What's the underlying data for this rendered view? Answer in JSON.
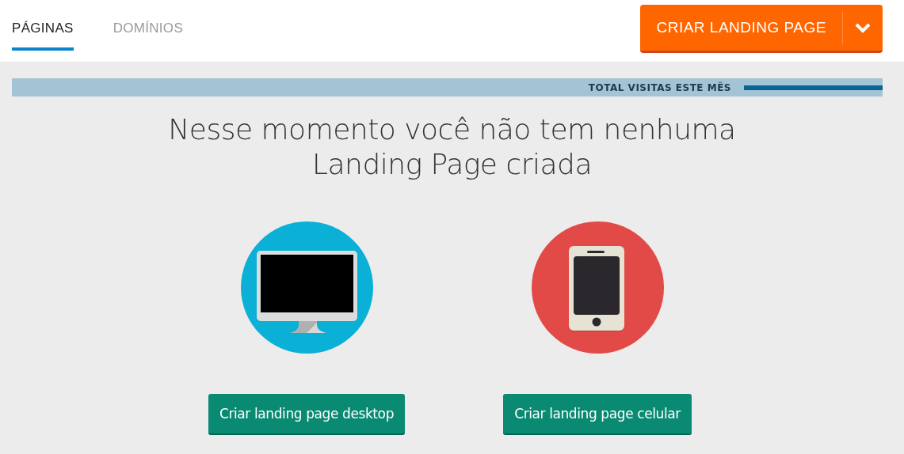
{
  "tabs": [
    {
      "label": "PÁGINAS",
      "selected": true
    },
    {
      "label": "DOMÍNIOS",
      "selected": false
    }
  ],
  "create_button": {
    "label": "CRIAR LANDING PAGE"
  },
  "visits_bar": {
    "label": "TOTAL VISITAS ESTE MÊS"
  },
  "headline": "Nesse momento você não tem nenhuma Landing Page criada",
  "options": [
    {
      "kind": "desktop",
      "button": "Criar landing page desktop"
    },
    {
      "kind": "mobile",
      "button": "Criar landing page celular"
    }
  ]
}
